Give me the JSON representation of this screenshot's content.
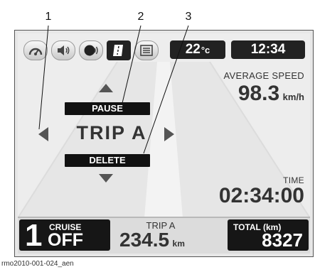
{
  "callouts": [
    "1",
    "2",
    "3"
  ],
  "topbar": {
    "icons": [
      "speedometer-icon",
      "speaker-icon",
      "headset-icon",
      "trip-icon",
      "list-icon"
    ],
    "temperature_value": "22",
    "temperature_unit": "°c",
    "clock": "12:34"
  },
  "average_speed": {
    "label": "AVERAGE SPEED",
    "value": "98.3",
    "unit": "km/h"
  },
  "trip": {
    "title": "TRIP A",
    "pause_label": "PAUSE",
    "delete_label": "DELETE"
  },
  "time": {
    "label": "TIME",
    "value": "02:34:00"
  },
  "bottom": {
    "gear": "1",
    "cruise_label": "CRUISE",
    "cruise_state": "OFF",
    "trip_label": "TRIP A",
    "trip_value": "234.5",
    "trip_unit": "km",
    "total_label": "TOTAL (km)",
    "total_value": "8327"
  },
  "caption": "rmo2010-001-024_aen",
  "colors": {
    "screen": "#ededed",
    "dark": "#161616",
    "text": "#333333"
  }
}
